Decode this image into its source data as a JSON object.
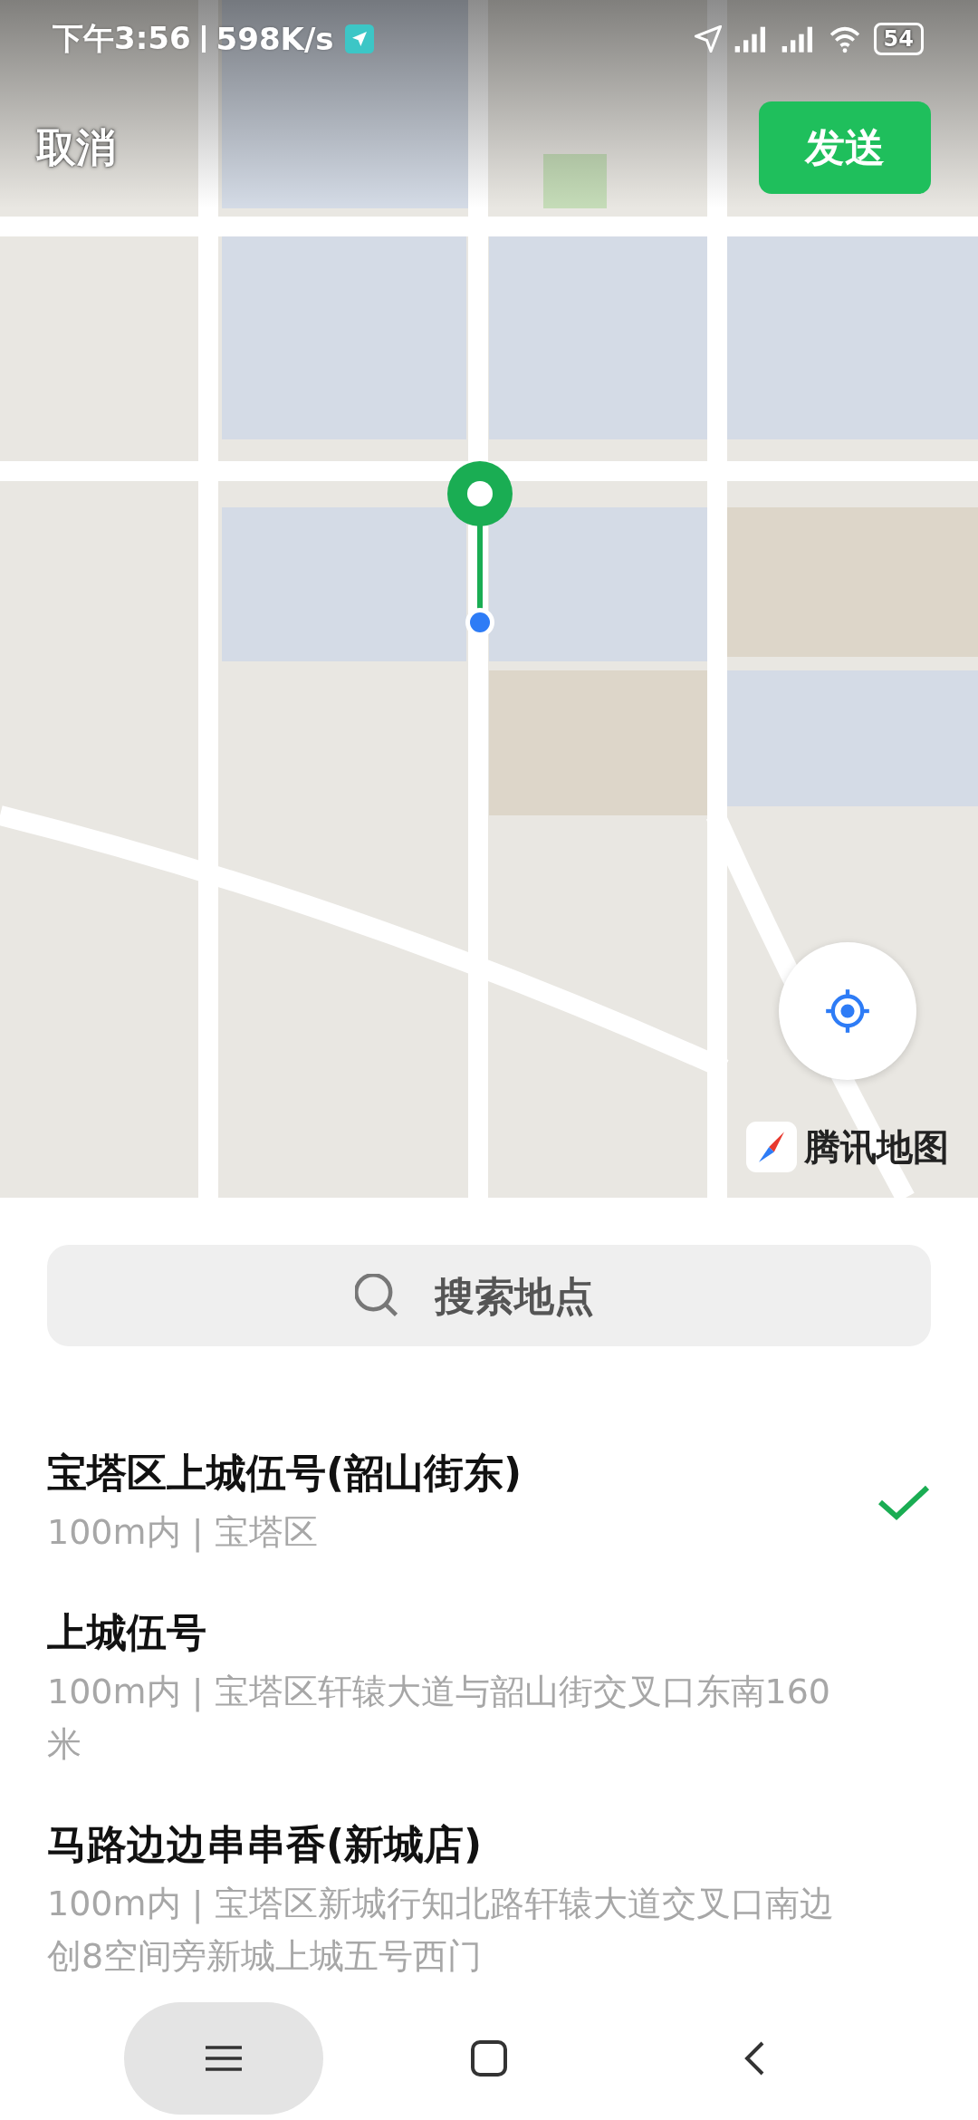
{
  "status_bar": {
    "time": "下午3:56",
    "speed": "598K/s",
    "battery": "54"
  },
  "header": {
    "cancel": "取消",
    "send": "发送"
  },
  "map": {
    "brand": "腾讯地图"
  },
  "search": {
    "placeholder": "搜索地点"
  },
  "places": [
    {
      "name": "宝塔区上城伍号(韶山街东)",
      "detail": "100m内 | 宝塔区",
      "selected": true
    },
    {
      "name": "上城伍号",
      "detail": "100m内 | 宝塔区轩辕大道与韶山街交叉口东南160米",
      "selected": false
    },
    {
      "name": "马路边边串串香(新城店)",
      "detail": "100m内 | 宝塔区新城行知北路轩辕大道交叉口南边创8空间旁新城上城五号西门",
      "selected": false
    }
  ]
}
